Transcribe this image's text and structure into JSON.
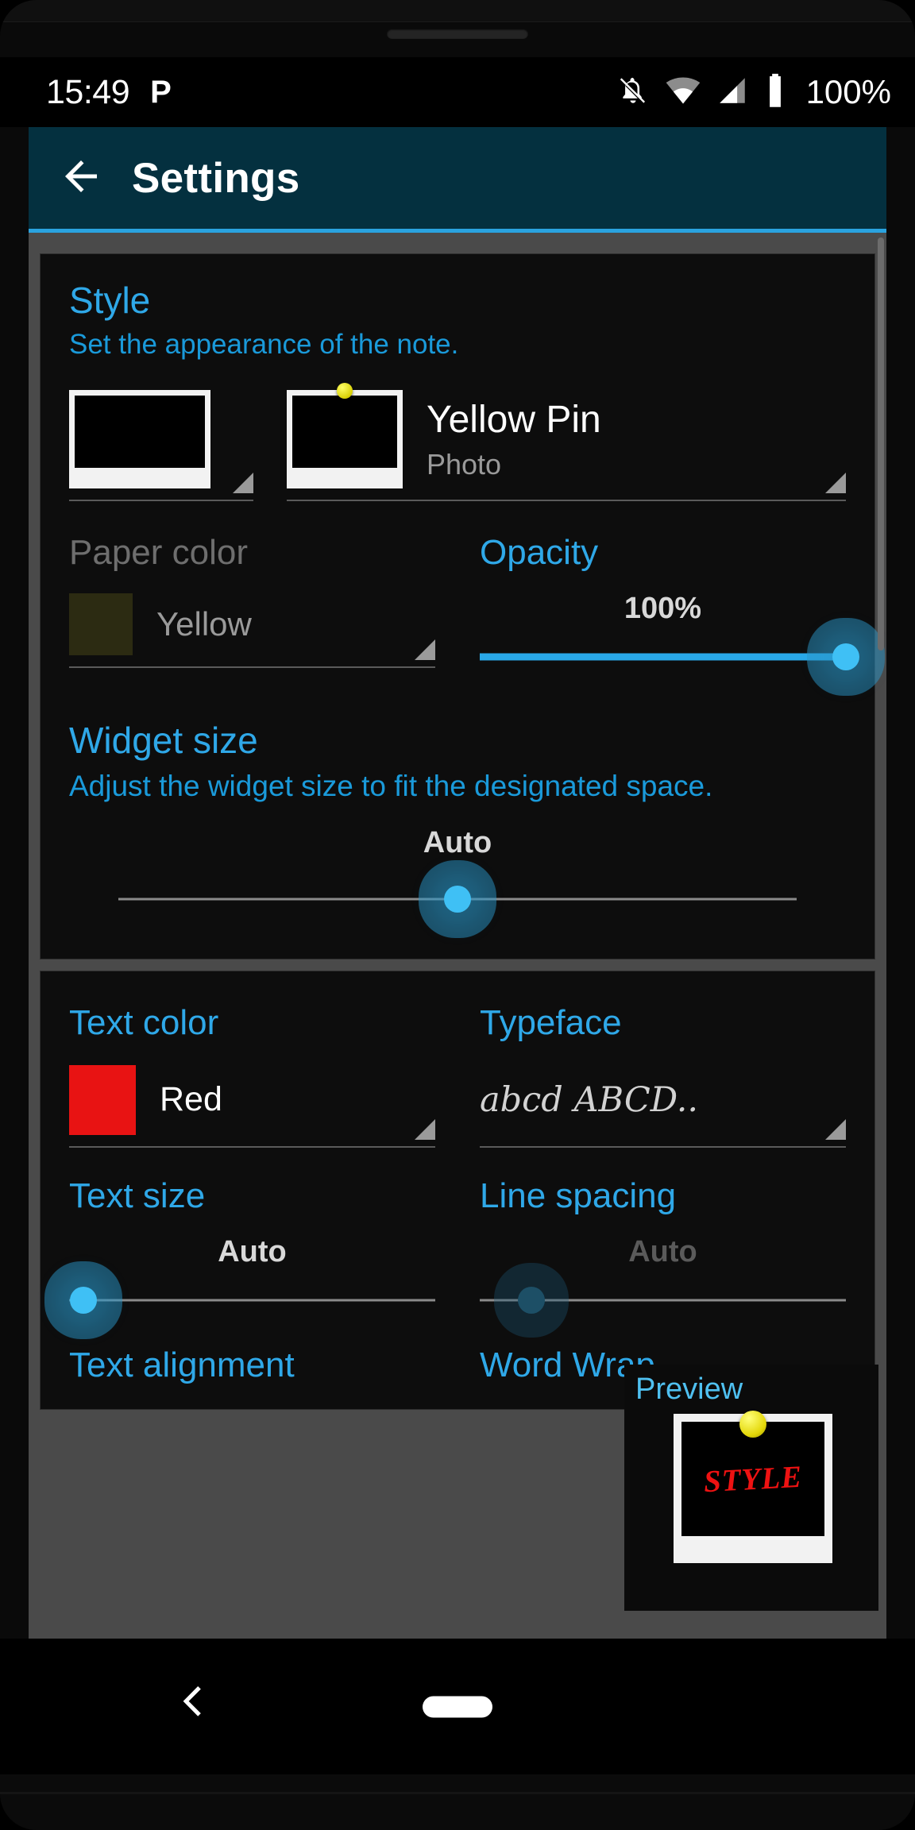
{
  "status_bar": {
    "time": "15:49",
    "app_glyph": "P",
    "battery_percent": "100%",
    "icons": [
      "bell-off-icon",
      "wifi-icon",
      "signal-icon",
      "battery-icon"
    ]
  },
  "app_bar": {
    "back_label": "back-arrow",
    "title": "Settings",
    "accent_color": "#2aa3e0",
    "background_color": "#04303f"
  },
  "style_section": {
    "title": "Style",
    "subtitle": "Set the appearance of the note.",
    "note_style_name": "Yellow Pin",
    "note_style_type": "Photo",
    "paper_color": {
      "label": "Paper color",
      "value": "Yellow",
      "swatch_color": "#2c2b12",
      "enabled": false
    },
    "opacity": {
      "label": "Opacity",
      "value": "100%",
      "percent": 100
    }
  },
  "widget_size_section": {
    "title": "Widget size",
    "subtitle": "Adjust the widget size to fit the designated space.",
    "value": "Auto",
    "percent": 50
  },
  "text_section": {
    "text_color": {
      "label": "Text color",
      "value": "Red",
      "swatch_color": "#e81313"
    },
    "typeface": {
      "label": "Typeface",
      "sample": "abcd ABCD.."
    },
    "text_size": {
      "label": "Text size",
      "value": "Auto",
      "percent": 0
    },
    "line_spacing": {
      "label": "Line spacing",
      "value": "Auto",
      "percent": 12
    },
    "text_alignment": {
      "label": "Text alignment"
    },
    "word_wrap": {
      "label": "Word Wrap"
    }
  },
  "preview": {
    "label": "Preview",
    "note_text": "STYLE",
    "note_text_color": "#ee1212",
    "pin_color": "#e3d708"
  },
  "navigation_bar": {
    "back_label": "nav-back",
    "home_label": "nav-home-pill"
  }
}
